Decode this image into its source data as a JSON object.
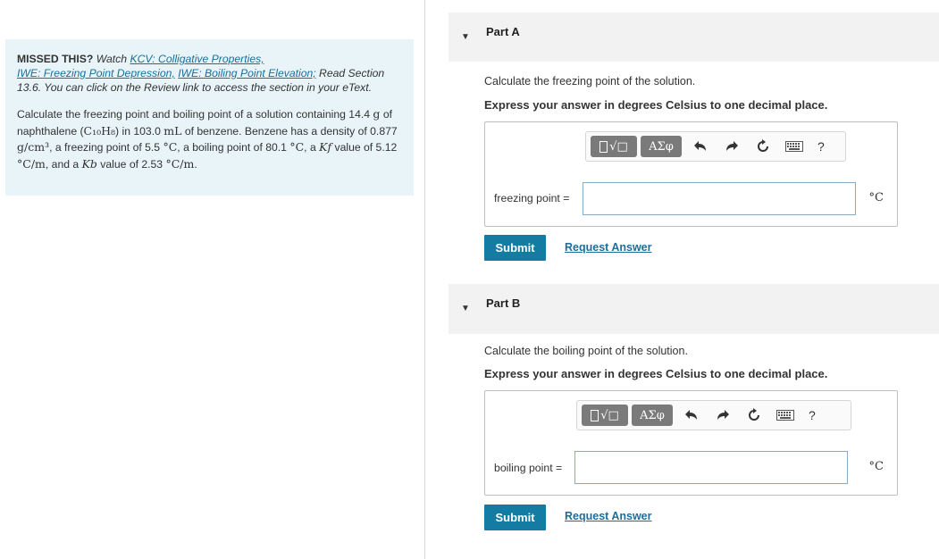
{
  "intro": {
    "missed_label": "MISSED THIS?",
    "watch_text": "Watch",
    "link_kcv": "KCV: Colligative Properties,",
    "link_iwe_fp": "IWE: Freezing Point Depression,",
    "link_iwe_bp": "IWE: Boiling Point Elevation;",
    "read_text": "Read Section 13.6. You can click on the Review link to access the section in your eText.",
    "problem": {
      "t1": "Calculate the freezing point and boiling point of a solution containing 14.4",
      "mass_unit": "g",
      "t2": "of naphthalene (",
      "formula": "C₁₀H₈",
      "t3": ") in 103.0",
      "vol_unit": "mL",
      "t4": "of benzene. Benzene has a density of 0.877",
      "density_unit": "g/cm³",
      "t5": ", a freezing point of 5.5",
      "temp_unit": "°C",
      "t6": ", a boiling point of 80.1",
      "t7": ", a",
      "kf": "Kf",
      "t8": "value of 5.12",
      "molal_unit": "°C/m",
      "t9": ", and a",
      "kb": "Kb",
      "t10": "value of 2.53",
      "t11": "."
    }
  },
  "toolbar": {
    "greek_label": "ΑΣφ",
    "help_label": "?",
    "icons": [
      "template-icon",
      "undo-icon",
      "redo-icon",
      "reset-icon",
      "keyboard-icon",
      "help-icon"
    ]
  },
  "part_a": {
    "title": "Part A",
    "question": "Calculate the freezing point of the solution.",
    "instruction": "Express your answer in degrees Celsius to one decimal place.",
    "field_label": "freezing point =",
    "field_value": "",
    "unit": "°C",
    "submit_label": "Submit",
    "request_label": "Request Answer"
  },
  "part_b": {
    "title": "Part B",
    "question": "Calculate the boiling point of the solution.",
    "instruction": "Express your answer in degrees Celsius to one decimal place.",
    "field_label": "boiling point =",
    "field_value": "",
    "unit": "°C",
    "submit_label": "Submit",
    "request_label": "Request Answer"
  }
}
